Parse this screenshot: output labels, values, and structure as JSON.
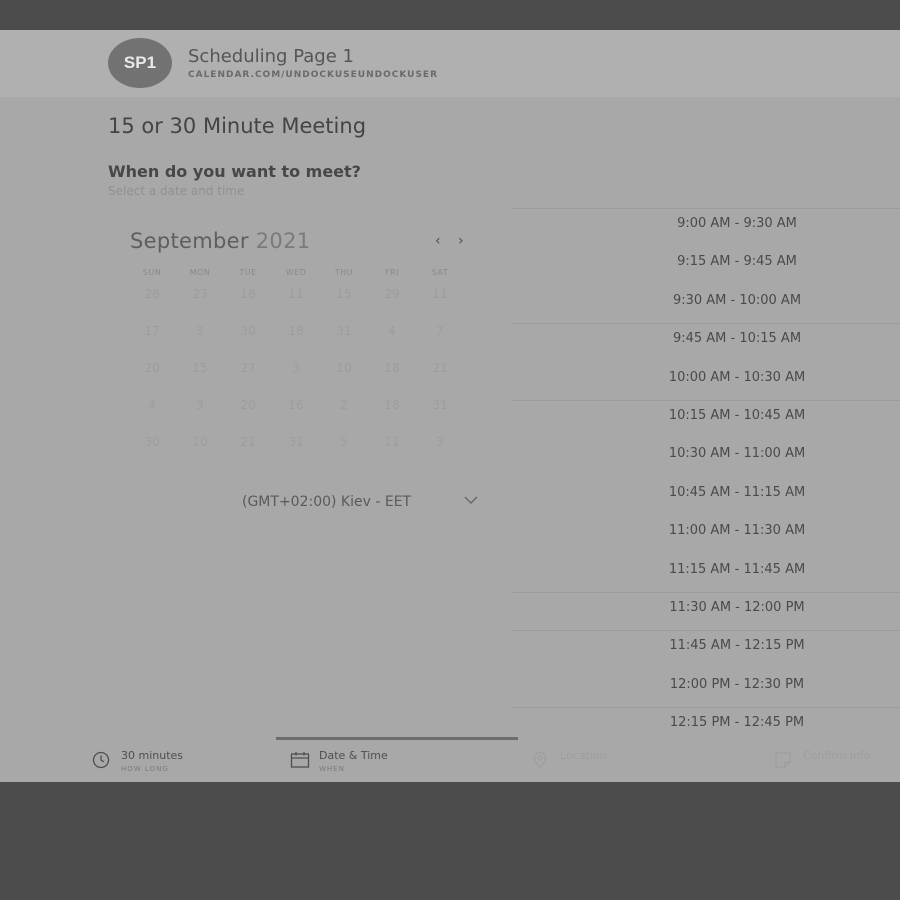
{
  "header": {
    "avatar_initials": "SP1",
    "page_name": "Scheduling Page 1",
    "page_url": "CALENDAR.COM/UNDOCKUSEUNDOCKUSER"
  },
  "meeting": {
    "title": "15 or 30 Minute Meeting",
    "question": "When do you want to meet?",
    "subtitle": "Select a date and time"
  },
  "calendar": {
    "month": "September",
    "year": "2021",
    "prev_label": "‹",
    "next_label": "›",
    "weekdays": [
      "SUN",
      "MON",
      "TUE",
      "WED",
      "THU",
      "FRI",
      "SAT"
    ],
    "weeks": [
      [
        "28",
        "23",
        "18",
        "11",
        "15",
        "29",
        "11"
      ],
      [
        "17",
        "3",
        "30",
        "18",
        "31",
        "4",
        "7"
      ],
      [
        "20",
        "15",
        "27",
        "3",
        "10",
        "18",
        "21"
      ],
      [
        "4",
        "3",
        "20",
        "16",
        "2",
        "18",
        "31"
      ],
      [
        "30",
        "10",
        "21",
        "31",
        "5",
        "11",
        "3"
      ]
    ]
  },
  "timezone": {
    "label": "(GMT+02:00) Kiev - EET"
  },
  "time_slots": [
    "9:00 AM - 9:30 AM",
    "9:15 AM - 9:45 AM",
    "9:30 AM - 10:00 AM",
    "9:45 AM - 10:15 AM",
    "10:00 AM - 10:30 AM",
    "10:15 AM - 10:45 AM",
    "10:30 AM - 11:00 AM",
    "10:45 AM - 11:15 AM",
    "11:00 AM - 11:30 AM",
    "11:15 AM - 11:45 AM",
    "11:30 AM - 12:00 PM",
    "11:45 AM - 12:15 PM",
    "12:00 PM - 12:30 PM",
    "12:15 PM - 12:45 PM"
  ],
  "steps": {
    "duration": {
      "title": "30 minutes",
      "caption": "HOW LONG",
      "icon": "clock-icon"
    },
    "datetime": {
      "title": "Date & Time",
      "caption": "WHEN",
      "icon": "calendar-icon"
    },
    "location": {
      "title": "Location",
      "caption": "WHAT",
      "icon": "location-pin-icon"
    },
    "confirm": {
      "title": "Confirm Info",
      "caption": "WHO",
      "icon": "note-icon"
    }
  },
  "colors": {
    "backdrop": "#4c4c4c",
    "card": "#a8a8a8",
    "header": "#b0b0b0",
    "avatar": "#727272"
  }
}
